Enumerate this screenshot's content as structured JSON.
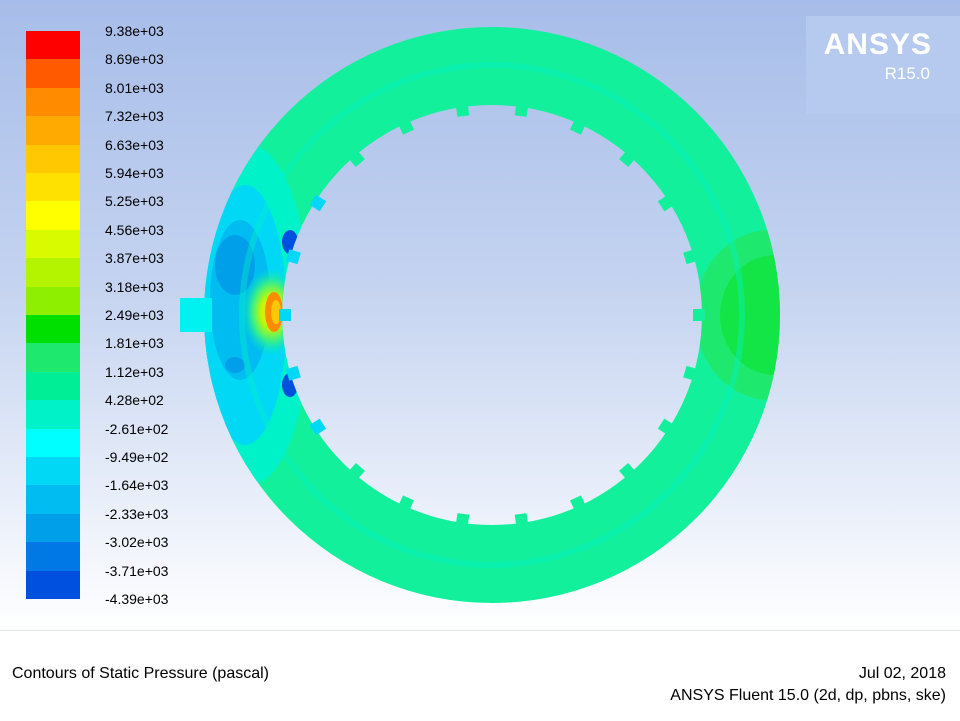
{
  "logo": {
    "name": "ANSYS",
    "revision": "R15.0"
  },
  "colorbar": {
    "labels": [
      "9.38e+03",
      "8.69e+03",
      "8.01e+03",
      "7.32e+03",
      "6.63e+03",
      "5.94e+03",
      "5.25e+03",
      "4.56e+03",
      "3.87e+03",
      "3.18e+03",
      "2.49e+03",
      "1.81e+03",
      "1.12e+03",
      "4.28e+02",
      "-2.61e+02",
      "-9.49e+02",
      "-1.64e+03",
      "-2.33e+03",
      "-3.02e+03",
      "-3.71e+03",
      "-4.39e+03"
    ],
    "colors": [
      "#ff0000",
      "#ff5a00",
      "#ff8c00",
      "#ffaa00",
      "#ffc800",
      "#ffe100",
      "#ffff00",
      "#d8fb00",
      "#b4f400",
      "#8ef000",
      "#00e000",
      "#1ee86e",
      "#00ee96",
      "#00f2c8",
      "#00ffff",
      "#00d8f6",
      "#00bcf0",
      "#009fea",
      "#0078e6",
      "#0050e0",
      "#0000ff"
    ]
  },
  "colors": {
    "annulus": "#12f09c",
    "low_pressure_region": "#00c0ee",
    "background_top": "#a7bde9"
  },
  "footer": {
    "title": "Contours of Static Pressure (pascal)",
    "date": "Jul 02, 2018",
    "solver": "ANSYS Fluent 15.0 (2d, dp, pbns, ske)"
  }
}
